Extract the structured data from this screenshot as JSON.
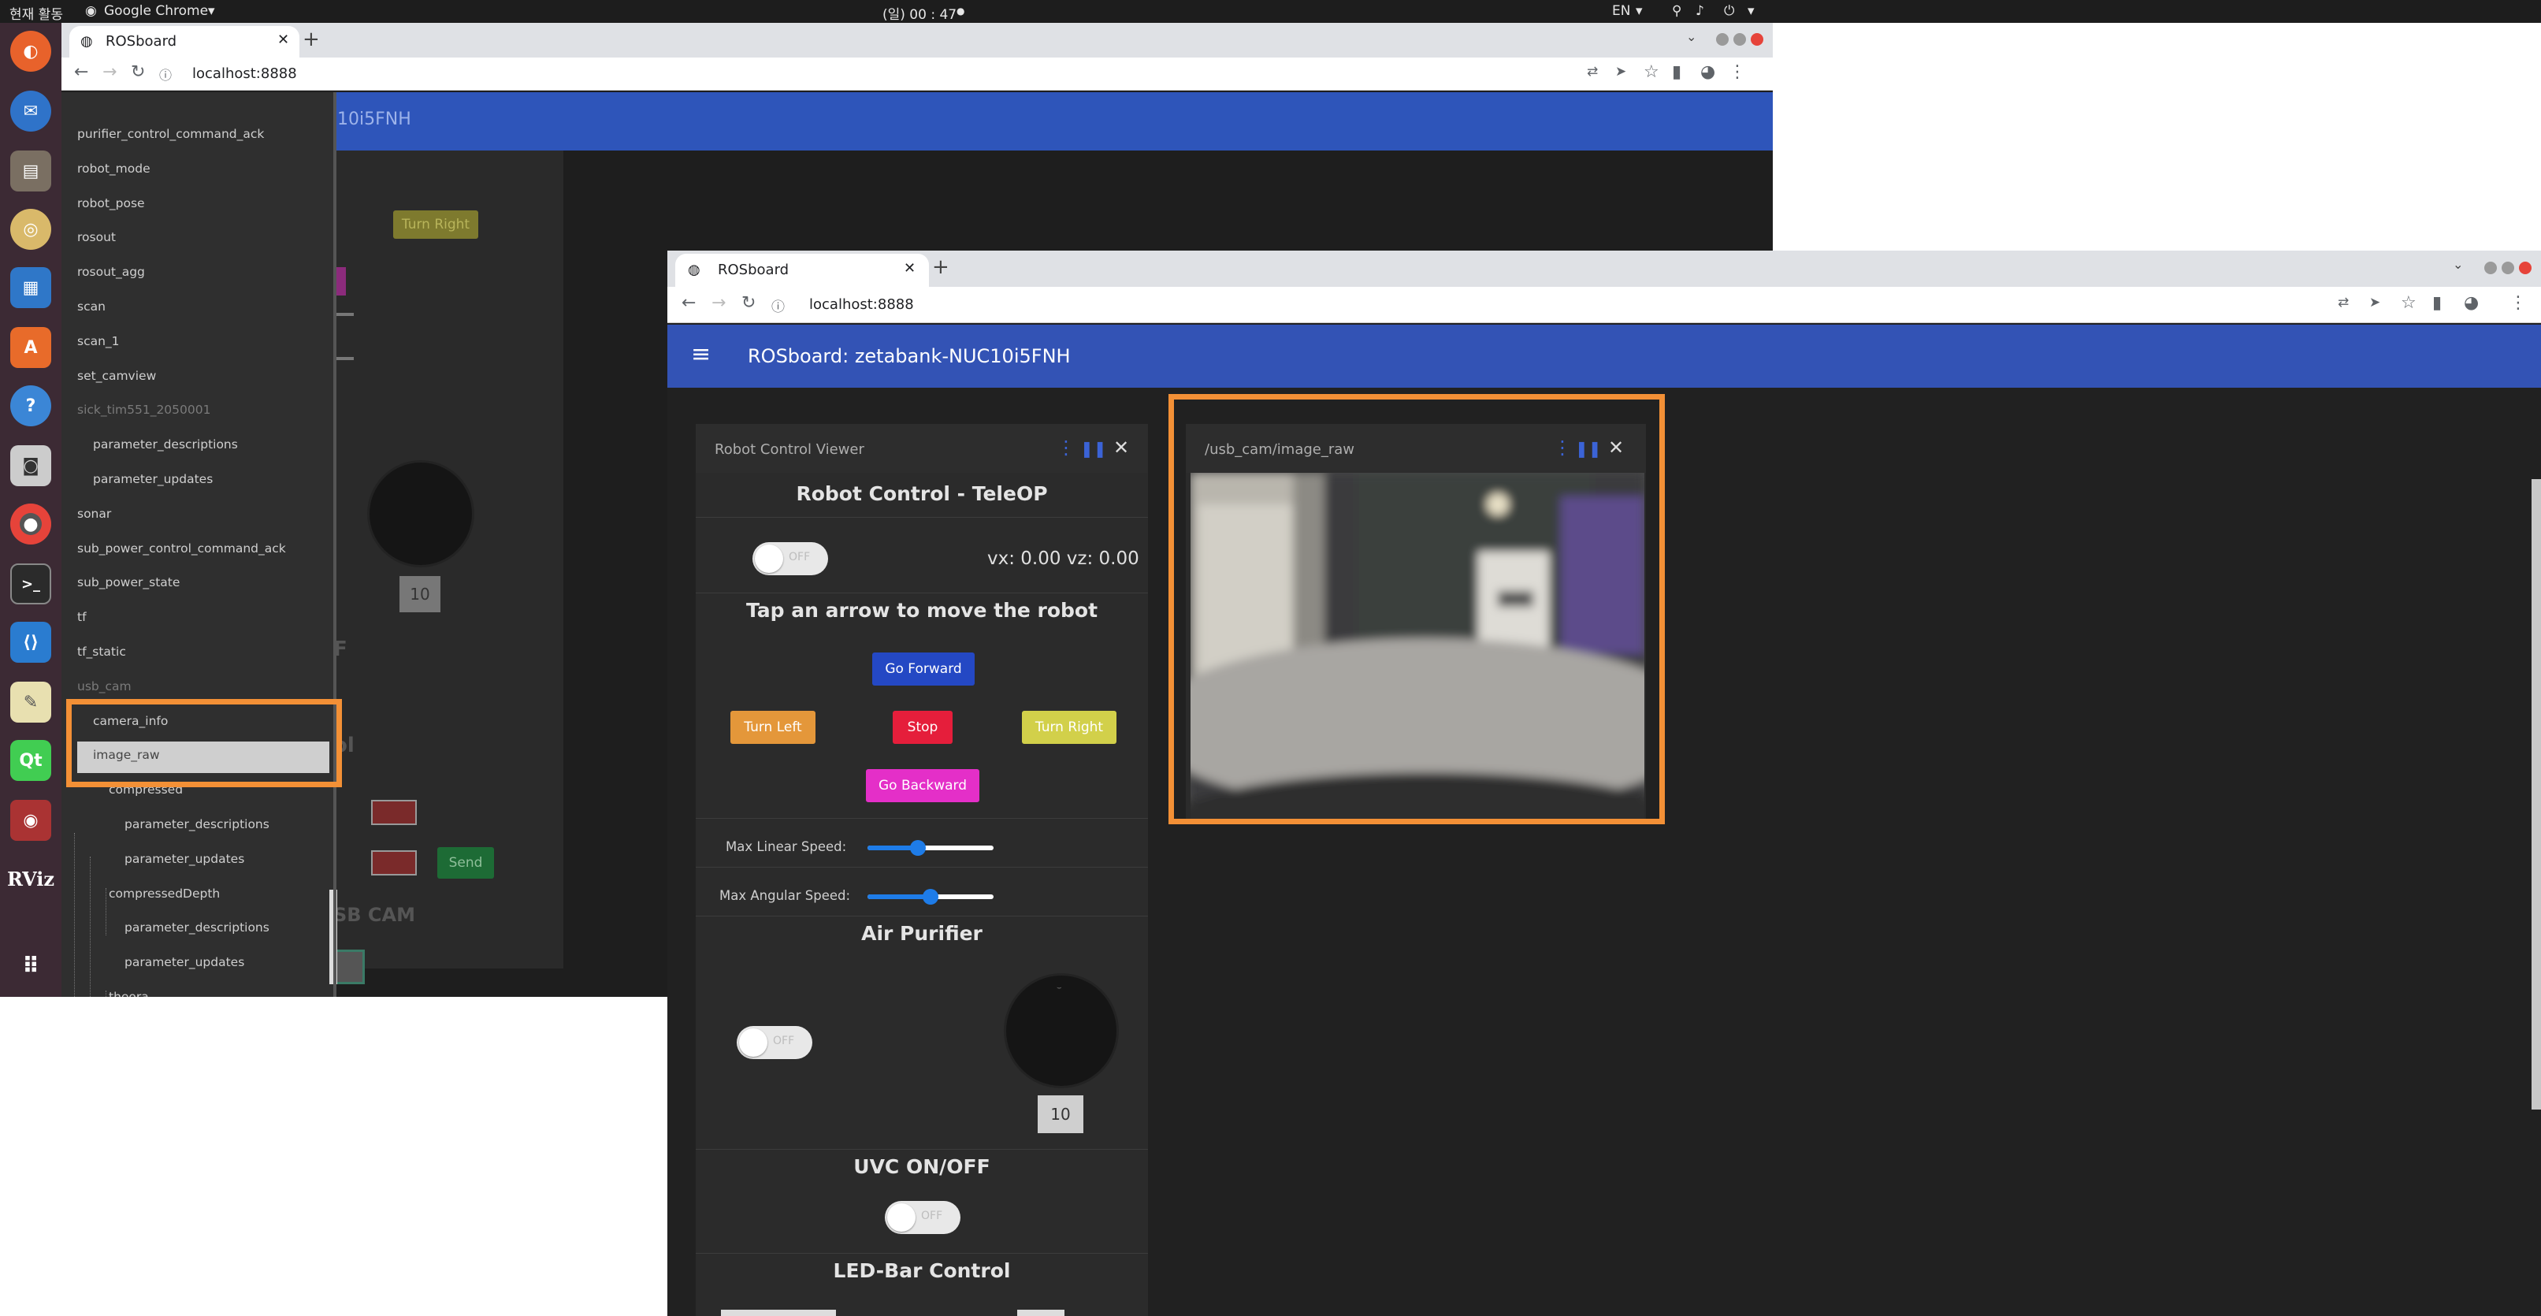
{
  "topbar": {
    "activities": "현재 활동",
    "app_menu": "Google Chrome",
    "clock": "(일) 00 : 47",
    "lang": "EN"
  },
  "back_window": {
    "tab_title": "ROSboard",
    "url": "localhost:8888",
    "header_partial": "10i5FNH",
    "bg_turn_right": "Turn Right",
    "bg_number": "10",
    "bg_letter_f": "F",
    "bg_ol": "ol",
    "bg_send": "Send",
    "bg_usbcam": "SB CAM",
    "drawer_items": [
      {
        "label": "purifier_control_command_ack",
        "level": 0,
        "dim": false
      },
      {
        "label": "robot_mode",
        "level": 0,
        "dim": false
      },
      {
        "label": "robot_pose",
        "level": 0,
        "dim": false
      },
      {
        "label": "rosout",
        "level": 0,
        "dim": false
      },
      {
        "label": "rosout_agg",
        "level": 0,
        "dim": false
      },
      {
        "label": "scan",
        "level": 0,
        "dim": false
      },
      {
        "label": "scan_1",
        "level": 0,
        "dim": false
      },
      {
        "label": "set_camview",
        "level": 0,
        "dim": false
      },
      {
        "label": "sick_tim551_2050001",
        "level": 0,
        "dim": true
      },
      {
        "label": "parameter_descriptions",
        "level": 1,
        "dim": false
      },
      {
        "label": "parameter_updates",
        "level": 1,
        "dim": false
      },
      {
        "label": "sonar",
        "level": 0,
        "dim": false
      },
      {
        "label": "sub_power_control_command_ack",
        "level": 0,
        "dim": false
      },
      {
        "label": "sub_power_state",
        "level": 0,
        "dim": false
      },
      {
        "label": "tf",
        "level": 0,
        "dim": false
      },
      {
        "label": "tf_static",
        "level": 0,
        "dim": false
      },
      {
        "label": "usb_cam",
        "level": 0,
        "dim": true
      },
      {
        "label": "camera_info",
        "level": 1,
        "dim": false
      },
      {
        "label": "image_raw",
        "level": 1,
        "dim": false,
        "selected": true
      },
      {
        "label": "compressed",
        "level": 2,
        "dim": false
      },
      {
        "label": "parameter_descriptions",
        "level": 3,
        "dim": false
      },
      {
        "label": "parameter_updates",
        "level": 3,
        "dim": false
      },
      {
        "label": "compressedDepth",
        "level": 2,
        "dim": false
      },
      {
        "label": "parameter_descriptions",
        "level": 3,
        "dim": false
      },
      {
        "label": "parameter_updates",
        "level": 3,
        "dim": false
      },
      {
        "label": "theora",
        "level": 2,
        "dim": false
      }
    ]
  },
  "front_window": {
    "tab_title": "ROSboard",
    "url": "localhost:8888",
    "app_title": "ROSboard: zetabank-NUC10i5FNH",
    "control_card": {
      "title": "Robot Control Viewer",
      "teleop_heading": "Robot Control - TeleOP",
      "toggle_label": "OFF",
      "velocity": "vx: 0.00 vz: 0.00",
      "instruction": "Tap an arrow to move the robot",
      "go_forward": "Go Forward",
      "turn_left": "Turn Left",
      "stop": "Stop",
      "turn_right": "Turn Right",
      "go_backward": "Go Backward",
      "max_linear_label": "Max Linear Speed:",
      "max_linear_value": 0.4,
      "max_angular_label": "Max Angular Speed:",
      "max_angular_value": 0.5,
      "air_heading": "Air Purifier",
      "air_toggle_label": "OFF",
      "air_level": "10",
      "uvc_heading": "UVC ON/OFF",
      "uvc_toggle_label": "OFF",
      "led_heading": "LED-Bar Control"
    },
    "camera_card": {
      "title": "/usb_cam/image_raw"
    }
  },
  "colors": {
    "accent_blue": "#3353b5",
    "go_forward": "#2448c4",
    "turn_left": "#e4973a",
    "stop": "#e51e3b",
    "turn_right": "#d2d04a",
    "go_backward": "#e42fc8",
    "highlight": "#f39036"
  }
}
